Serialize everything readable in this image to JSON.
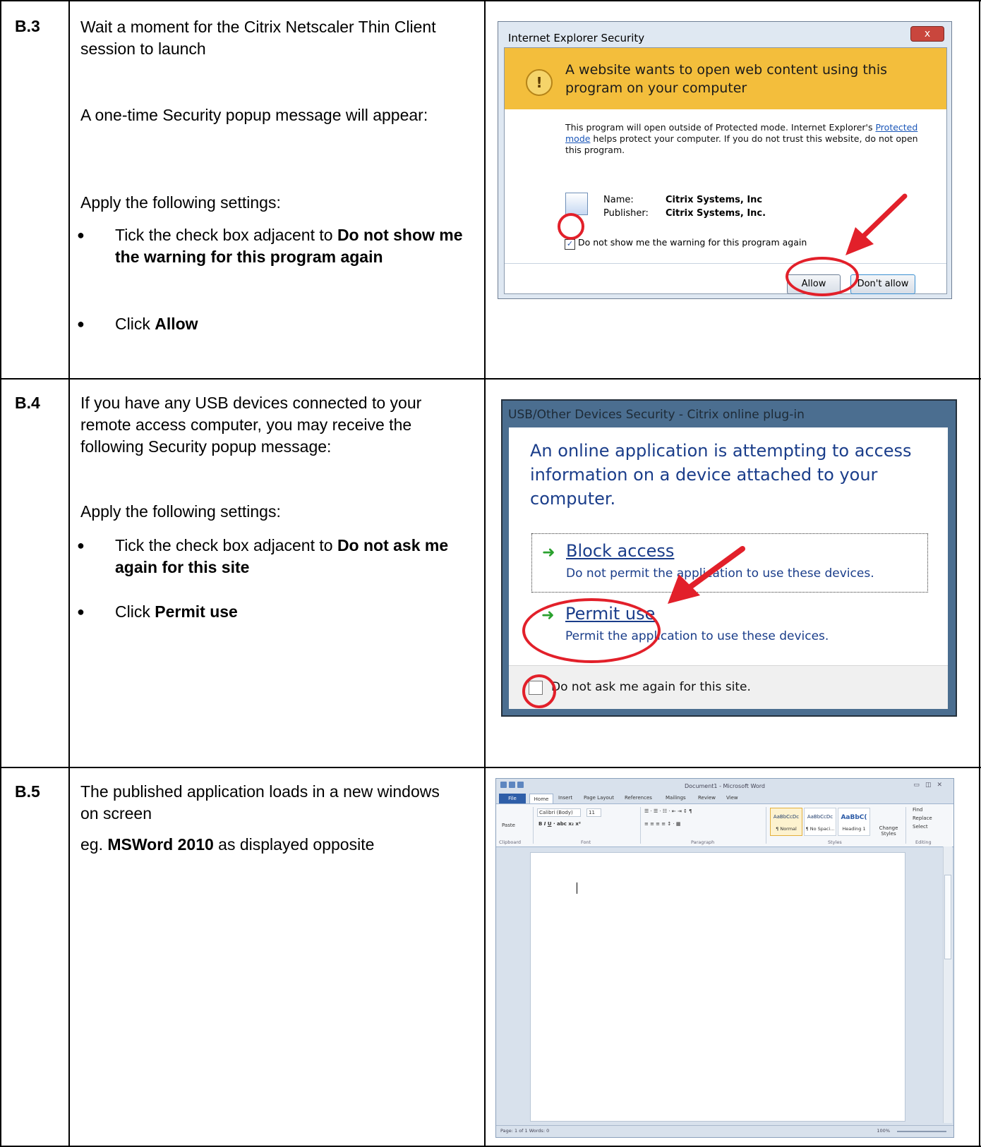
{
  "rows": [
    {
      "step": "B.3",
      "intro": "Wait a moment for the Citrix Netscaler Thin Client session to launch",
      "popup_note": "A one-time Security popup message will appear:",
      "apply": "Apply the following settings:",
      "bullet1_pre": "Tick the check box adjacent to ",
      "bullet1_bold": "Do not show me the warning for this program again",
      "bullet2_pre": "Click ",
      "bullet2_bold": "Allow",
      "dialog": {
        "title": "Internet Explorer Security",
        "close": "x",
        "heading": "A website wants to open web content using this program on your computer",
        "body_pre": "This program will open outside of Protected mode. Internet Explorer's ",
        "body_link": "Protected mode",
        "body_post": " helps protect your computer. If you do not trust this website, do not open this program.",
        "name_label": "Name:",
        "name_value": "Citrix Systems, Inc",
        "publisher_label": "Publisher:",
        "publisher_value": "Citrix Systems, Inc.",
        "checkbox_label": "Do not show me the warning for this program again",
        "checkbox_checked": true,
        "allow_button": "Allow",
        "deny_button": "Don't allow"
      }
    },
    {
      "step": "B.4",
      "intro": "If you have any USB devices connected to your remote access computer, you may receive the following Security popup message:",
      "apply": "Apply the following settings:",
      "bullet1_pre": "Tick the check box adjacent to ",
      "bullet1_bold": "Do not ask me again for this site",
      "bullet2_pre": "Click ",
      "bullet2_bold": "Permit use",
      "dialog": {
        "title": "USB/Other Devices Security - Citrix online plug-in",
        "heading": "An online application is attempting to access information on a device attached to your computer.",
        "block_title": "Block access",
        "block_desc": "Do not permit the application to use these devices.",
        "permit_title": "Permit use",
        "permit_desc": "Permit the application to use these devices.",
        "checkbox_label": "Do not ask me again for this site.",
        "checkbox_checked": false
      }
    },
    {
      "step": "B.5",
      "intro": "The published application loads in a new windows on screen",
      "eg_pre": "eg. ",
      "eg_bold": "MSWord 2010",
      "eg_post": " as displayed opposite",
      "word": {
        "title": "Document1 - Microsoft Word",
        "tabs": [
          "File",
          "Home",
          "Insert",
          "Page Layout",
          "References",
          "Mailings",
          "Review",
          "View"
        ],
        "font": "Calibri (Body)",
        "font_size": "11",
        "groups": [
          "Clipboard",
          "Font",
          "Paragraph",
          "Styles",
          "Editing"
        ],
        "paste": "Paste",
        "styles": [
          {
            "sample": "AaBbCcDc",
            "name": "¶ Normal"
          },
          {
            "sample": "AaBbCcDc",
            "name": "¶ No Spaci..."
          },
          {
            "sample": "AaBbC(",
            "name": "Heading 1"
          }
        ],
        "change_styles": "Change Styles",
        "editing": [
          "Find",
          "Replace",
          "Select"
        ],
        "status": "Page: 1 of 1   Words: 0",
        "zoom": "100%"
      }
    }
  ]
}
